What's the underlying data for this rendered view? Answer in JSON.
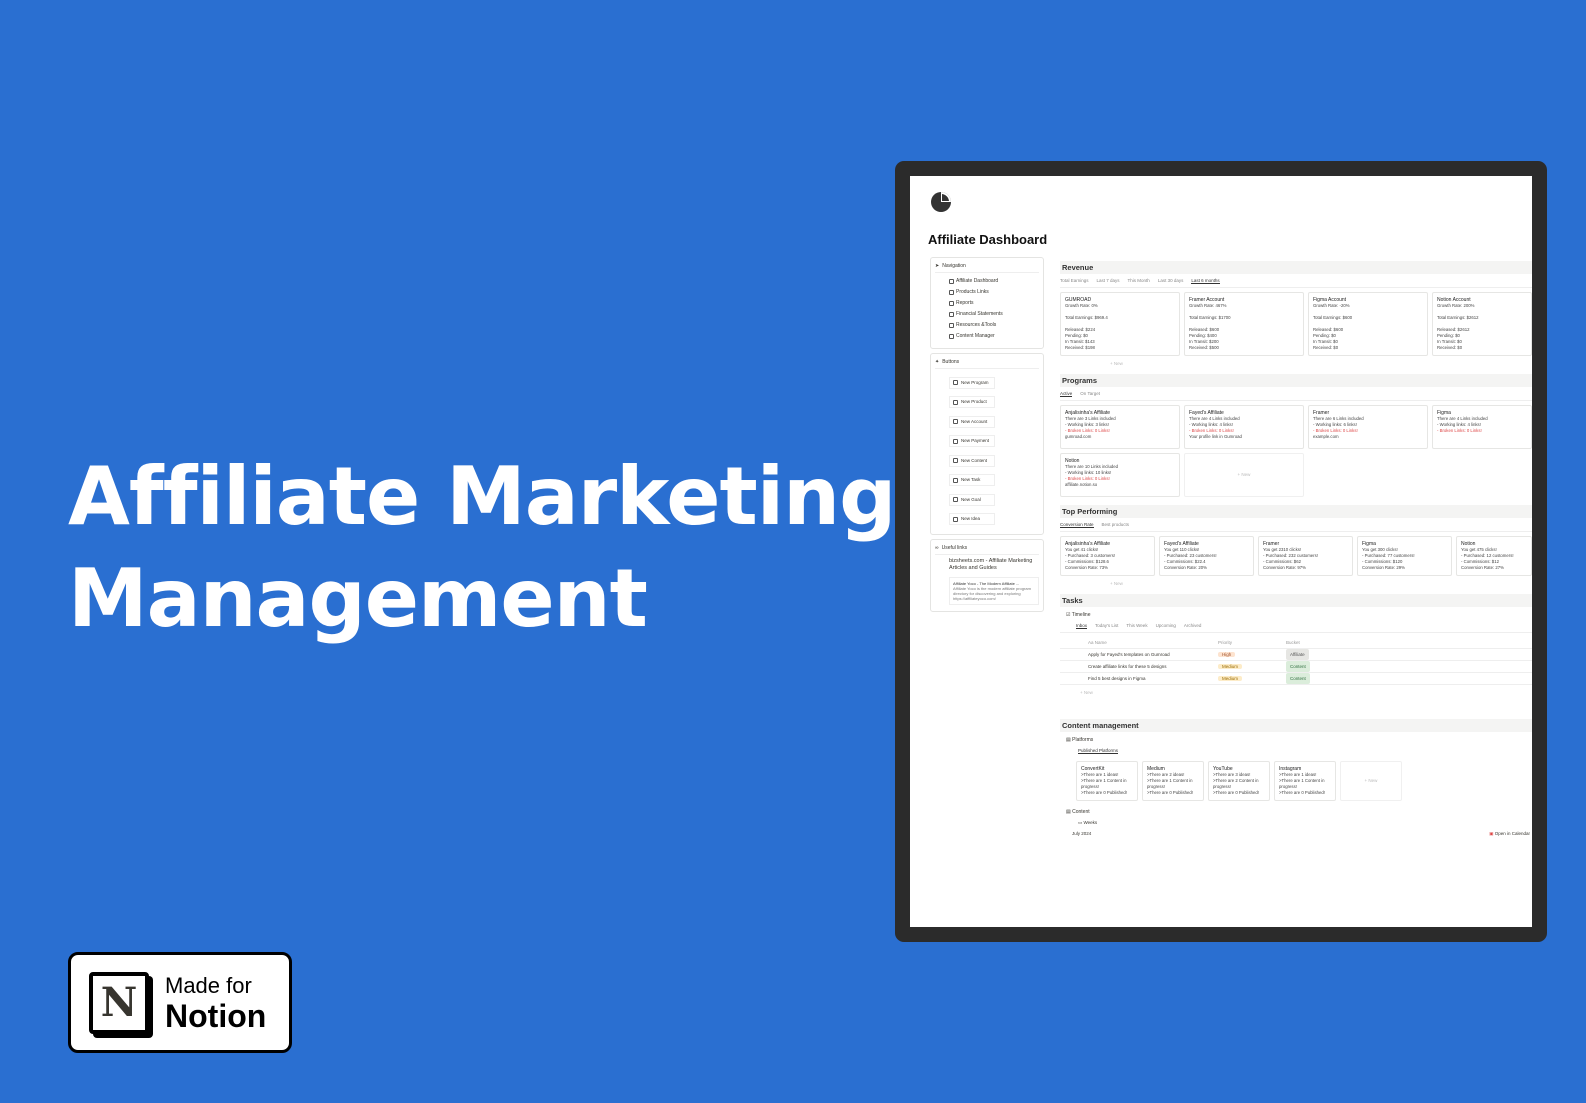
{
  "hero": {
    "line1": "Affiliate Marketing",
    "line2": "Management"
  },
  "badge": {
    "made_for": "Made for",
    "notion": "Notion",
    "logo_letter": "N"
  },
  "page": {
    "title": "Affiliate Dashboard"
  },
  "sidebar": {
    "navigation": {
      "heading": "Navigation",
      "items": [
        "Affiliate Dashboard",
        "Products Links",
        "Reports",
        "Financial Statements",
        "Resources &Tools",
        "Content Manager"
      ]
    },
    "buttons": {
      "heading": "Buttons",
      "items": [
        "New Program",
        "New Product",
        "New Account",
        "New Payment",
        "New Content",
        "New Task",
        "New Goal",
        "New Idea"
      ]
    },
    "useful_links": {
      "heading": "Useful links",
      "link": "bizsheets.com - Affiliate Marketing Articles and Guides",
      "card_title": "Affiliate Yoco - The Modern Affiliate ...",
      "card_desc": "Affiliate Yoco is the modern affiliate program directory for discovering and exploring",
      "card_url": "https://affiliateyoco.com/"
    }
  },
  "revenue": {
    "heading": "Revenue",
    "tabs": [
      "Total Earnings",
      "Last 7 days",
      "This Month",
      "Last 30 days",
      "Last 6 months"
    ],
    "new": "+ New",
    "cards": [
      {
        "name": "GUMROAD",
        "growth": "Growth Rate: 0%",
        "total": "Total Earnings: $969.4",
        "lines": [
          "Released: $224",
          "Pending: $0",
          "In Transit: $143",
          "Received: $198"
        ]
      },
      {
        "name": "Framer Account",
        "growth": "Growth Rate: 467%",
        "total": "Total Earnings: $1700",
        "lines": [
          "Released: $600",
          "Pending: $400",
          "In Transit: $200",
          "Received: $500"
        ]
      },
      {
        "name": "Figma Account",
        "growth": "Growth Rate: -20%",
        "total": "Total Earnings: $600",
        "lines": [
          "Released: $600",
          "Pending: $0",
          "In Transit: $0",
          "Received: $0"
        ]
      },
      {
        "name": "Notion Account",
        "growth": "Growth Rate: 200%",
        "total": "Total Earnings: $2612",
        "lines": [
          "Released: $2612",
          "Pending: $0",
          "In Transit: $0",
          "Received: $0"
        ]
      }
    ]
  },
  "programs": {
    "heading": "Programs",
    "tabs": [
      "Active",
      "On Target"
    ],
    "new": "+ New",
    "cards": [
      {
        "name": "Anjalisinha's Affiliate",
        "lines": [
          "There are 3 Links included",
          "- Working links: 3 links!"
        ],
        "broken": "- Broken Links: 0 Links!",
        "url": "gumroad.com"
      },
      {
        "name": "Fayed's Affiliate",
        "lines": [
          "There are 4 Links included",
          "- Working links: 4 links!"
        ],
        "broken": "- Broken Links: 0 Links!",
        "url": "Your profile link in Gumroad"
      },
      {
        "name": "Framer",
        "lines": [
          "There are 6 Links included",
          "- Working links: 6 links!"
        ],
        "broken": "- Broken Links: 0 Links!",
        "url": "example.com"
      },
      {
        "name": "Figma",
        "lines": [
          "There are 4 Links included",
          "- Working links: 4 links!"
        ],
        "broken": "- Broken Links: 0 Links!",
        "url": ""
      },
      {
        "name": "Notion",
        "lines": [
          "There are 10 Links included",
          "- Working links: 10 links!"
        ],
        "broken": "- Broken Links: 0 Links!",
        "url": "affiliate.notion.so"
      }
    ]
  },
  "top": {
    "heading": "Top Performing",
    "tabs": [
      "Conversion Rate",
      "Best products"
    ],
    "new": "+ New",
    "cards": [
      {
        "name": "Anjalisinha's Affiliate",
        "clicks": "You get 41 clicks!",
        "purchased": "- Purchased: 3 customers!",
        "commission": "- Commissions: $128.6",
        "rate": "Conversion Rate: 73%"
      },
      {
        "name": "Fayed's Affiliate",
        "clicks": "You get 110 clicks!",
        "purchased": "- Purchased: 23 customers!",
        "commission": "- Commissions: $22.4",
        "rate": "Conversion Rate: 20%"
      },
      {
        "name": "Framer",
        "clicks": "You get 2310 clicks!",
        "purchased": "- Purchased: 232 customers!",
        "commission": "- Commissions: $62",
        "rate": "Conversion Rate: 97%"
      },
      {
        "name": "Figma",
        "clicks": "You get 300 clicks!",
        "purchased": "- Purchased: 77 customers!",
        "commission": "- Commissions: $120",
        "rate": "Conversion Rate: 29%"
      },
      {
        "name": "Notion",
        "clicks": "You get 475 clicks!",
        "purchased": "- Purchased: 12 customers!",
        "commission": "- Commissions: $12",
        "rate": "Conversion Rate: 27%"
      }
    ]
  },
  "tasks": {
    "heading": "Tasks",
    "timeline": "Timeline",
    "tabs": [
      "Inbox",
      "Today's List",
      "This Week",
      "Upcoming",
      "Archived"
    ],
    "cols": [
      "Aa Name",
      "Priority",
      "Bucket"
    ],
    "new": "+ New",
    "rows": [
      {
        "name": "Apply for Fayed's templates on Gumroad",
        "priority": "High",
        "bucket": "Affiliate"
      },
      {
        "name": "Create affiliate links for these 5 designs",
        "priority": "Medium",
        "bucket": "Content"
      },
      {
        "name": "Find 5 best designs in Figma",
        "priority": "Medium",
        "bucket": "Content"
      }
    ]
  },
  "content": {
    "heading": "Content management",
    "platforms": "Platforms",
    "published": "Published Platforms",
    "new": "+ New",
    "cards": [
      {
        "name": "ConvertKit",
        "lines": [
          ">There are 1 ideas!",
          ">There are 1 Content in progress!",
          ">There are 0 Published!"
        ]
      },
      {
        "name": "Medium",
        "lines": [
          ">There are 2 ideas!",
          ">There are 1 Content in progress!",
          ">There are 0 Published!"
        ]
      },
      {
        "name": "YouTube",
        "lines": [
          ">There are 3 ideas!",
          ">There are 2 Content in progress!",
          ">There are 0 Published!"
        ]
      },
      {
        "name": "Instagram",
        "lines": [
          ">There are 1 ideas!",
          ">There are 1 Content in progress!",
          ">There are 0 Published!"
        ]
      }
    ],
    "content_label": "Content",
    "weeks": "Weeks",
    "month": "July 2024",
    "calendar": "Open in Calendar"
  }
}
